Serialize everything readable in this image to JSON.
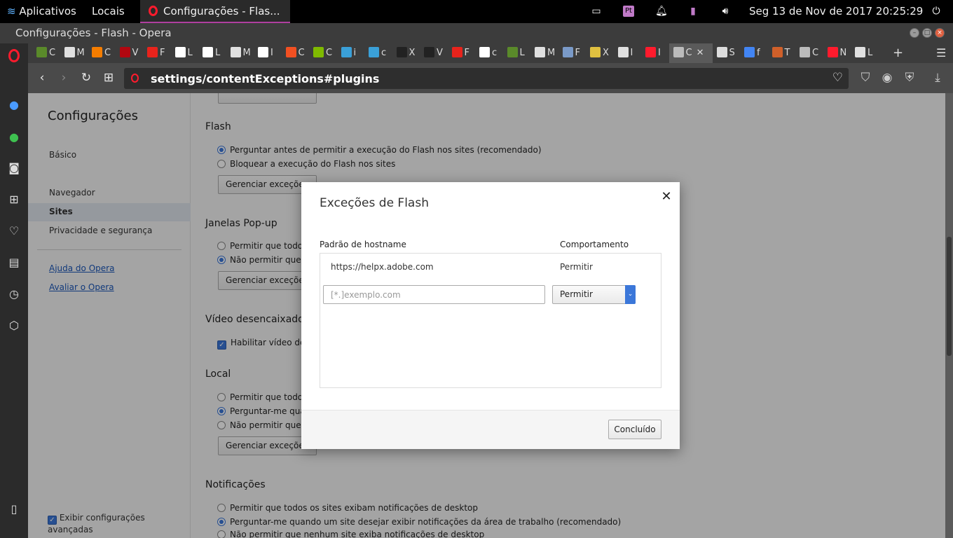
{
  "topbar": {
    "apps_label": "Aplicativos",
    "places_label": "Locais",
    "active_window": "Configurações - Flas...",
    "clock": "Seg 13 de Nov de 2017 20:25:29"
  },
  "window": {
    "title": "Configurações - Flash - Opera"
  },
  "tabs": [
    {
      "label": "C",
      "color": "#5a8a2a"
    },
    {
      "label": "M",
      "color": "#e0e0e0"
    },
    {
      "label": "C",
      "color": "#f57d00"
    },
    {
      "label": "V",
      "color": "#b20710"
    },
    {
      "label": "F",
      "color": "#e8231c"
    },
    {
      "label": "L",
      "color": "#ffffff"
    },
    {
      "label": "L",
      "color": "#ffffff"
    },
    {
      "label": "M",
      "color": "#e0e0e0"
    },
    {
      "label": "I",
      "color": "#ffffff"
    },
    {
      "label": "C",
      "color": "#f25022"
    },
    {
      "label": "C",
      "color": "#7fba00"
    },
    {
      "label": "i",
      "color": "#3aa0d8"
    },
    {
      "label": "c",
      "color": "#3aa0d8"
    },
    {
      "label": "X",
      "color": "#222222"
    },
    {
      "label": "V",
      "color": "#222222"
    },
    {
      "label": "F",
      "color": "#e8231c"
    },
    {
      "label": "c",
      "color": "#ffffff"
    },
    {
      "label": "L",
      "color": "#5a8a2a"
    },
    {
      "label": "M",
      "color": "#e0e0e0"
    },
    {
      "label": "F",
      "color": "#7a9ac8"
    },
    {
      "label": "X",
      "color": "#e0c040"
    },
    {
      "label": "I",
      "color": "#e0e0e0"
    },
    {
      "label": "I",
      "color": "#ff1b2d"
    },
    {
      "label": "C",
      "color": "#bbbbbb"
    },
    {
      "label": "S",
      "color": "#dddddd"
    },
    {
      "label": "f",
      "color": "#4285f4"
    },
    {
      "label": "T",
      "color": "#d0602a"
    },
    {
      "label": "C",
      "color": "#bbbbbb"
    },
    {
      "label": "N",
      "color": "#ff1b2d"
    },
    {
      "label": "L",
      "color": "#e0e0e0"
    }
  ],
  "address": {
    "url": "settings/contentExceptions#plugins"
  },
  "settings_nav": {
    "title": "Configurações",
    "basic": "Básico",
    "browser": "Navegador",
    "sites": "Sites",
    "privacy": "Privacidade e segurança",
    "help_link": "Ajuda do Opera",
    "rate_link": "Avaliar o Opera",
    "advanced_label": "Exibir configurações avançadas"
  },
  "content": {
    "flash": {
      "heading": "Flash",
      "opt1": "Perguntar antes de permitir a execução do Flash nos sites (recomendado)",
      "opt2": "Bloquear a execução do Flash nos sites",
      "manage": "Gerenciar exceções..."
    },
    "popups": {
      "heading": "Janelas Pop-up",
      "opt1": "Permitir que todos",
      "opt2": "Não permitir que ne",
      "manage": "Gerenciar exceções..."
    },
    "video": {
      "heading": "Vídeo desencaixado",
      "opt1": "Habilitar vídeo des"
    },
    "local": {
      "heading": "Local",
      "opt1": "Permitir que todos",
      "opt2": "Perguntar-me quan",
      "opt3": "Não permitir que ne",
      "manage": "Gerenciar exceções..."
    },
    "notifications": {
      "heading": "Notificações",
      "opt1": "Permitir que todos os sites exibam notificações de desktop",
      "opt2": "Perguntar-me quando um site desejar exibir notificações da área de trabalho (recomendado)",
      "opt3": "Não permitir que nenhum site exiba notificações de desktop"
    }
  },
  "dialog": {
    "title": "Exceções de Flash",
    "col_hostname": "Padrão de hostname",
    "col_behavior": "Comportamento",
    "rows": [
      {
        "host": "https://helpx.adobe.com",
        "behavior": "Permitir"
      }
    ],
    "input_placeholder": "[*.]exemplo.com",
    "select_value": "Permitir",
    "done_label": "Concluído"
  }
}
